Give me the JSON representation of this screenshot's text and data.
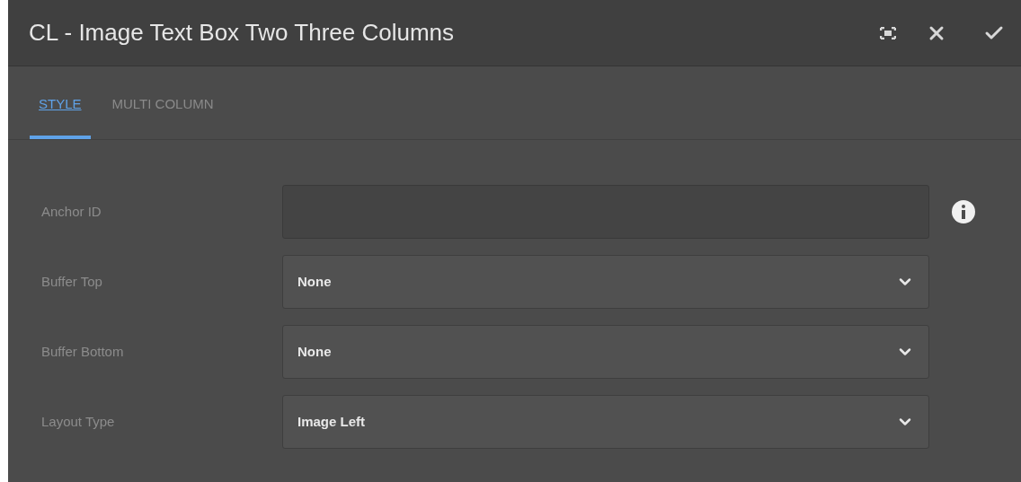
{
  "dialog": {
    "title": "CL - Image Text Box Two Three Columns"
  },
  "tabs": [
    {
      "label": "STYLE",
      "selected": true
    },
    {
      "label": "MULTI COLUMN",
      "selected": false
    }
  ],
  "fields": [
    {
      "kind": "text",
      "label": "Anchor ID",
      "info": true
    },
    {
      "kind": "select",
      "label": "Buffer Top",
      "value": "None"
    },
    {
      "kind": "select",
      "label": "Buffer Bottom",
      "value": "None"
    },
    {
      "kind": "select",
      "label": "Layout Type",
      "value": "Image Left"
    }
  ]
}
